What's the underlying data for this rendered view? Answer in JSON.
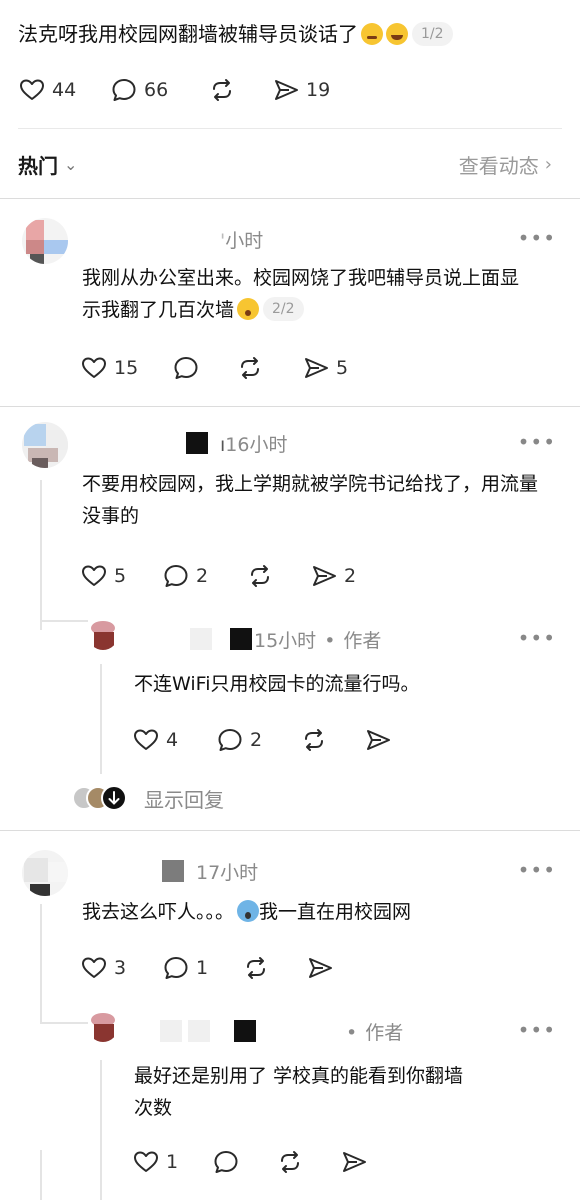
{
  "post": {
    "title": "法克呀我用校园网翻墙被辅导员谈话了",
    "page_indicator": "1/2",
    "likes": "44",
    "comments": "66",
    "shares": "19"
  },
  "sort": {
    "label": "热门",
    "view_activity": "查看动态"
  },
  "comments": [
    {
      "time": "小时",
      "text": "我刚从办公室出来。校园网饶了我吧辅导员说上面显示我翻了几百次墙",
      "page_indicator": "2/2",
      "likes": "15",
      "shares": "5"
    },
    {
      "time": "16小时",
      "text": "不要用校园网，我上学期就被学院书记给找了，用流量没事的",
      "likes": "5",
      "replies": "2",
      "shares": "2",
      "reply": {
        "time": "15小时",
        "author_tag": "作者",
        "text": "不连WiFi只用校园卡的流量行吗。",
        "likes": "4",
        "replies": "2"
      },
      "show_replies": "显示回复"
    },
    {
      "time": "17小时",
      "text_a": "我去这么吓人。。。",
      "text_b": "我一直在用校园网",
      "likes": "3",
      "replies": "1",
      "reply": {
        "author_tag": "作者",
        "text": "最好还是别用了 学校真的能看到你翻墙次数",
        "likes": "1"
      }
    }
  ],
  "icons": [
    "heart-icon",
    "comment-icon",
    "repost-icon",
    "send-icon",
    "more-icon",
    "chevron-down-icon",
    "chevron-right-icon"
  ]
}
